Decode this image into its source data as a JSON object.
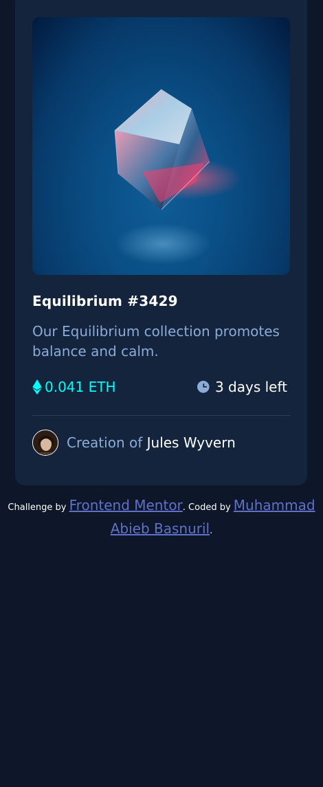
{
  "card": {
    "title": "Equilibrium #3429",
    "description": "Our Equilibrium collection promotes balance and calm.",
    "price": "0.041 ETH",
    "time_left": "3 days left",
    "creator_prefix": "Creation of",
    "creator_name": "Jules Wyvern"
  },
  "attribution": {
    "prefix": "Challenge by",
    "challenge_link": "Frontend Mentor",
    "middle": ". Coded by",
    "author_link": "Muhammad Abieb Basnuril",
    "suffix": "."
  },
  "colors": {
    "page_bg": "#0e1729",
    "card_bg": "#15243d",
    "cyan": "#00fff8",
    "soft_blue": "#8bacd9",
    "link": "#5f71c8"
  },
  "icons": {
    "eth": "ethereum-icon",
    "clock": "clock-icon"
  }
}
